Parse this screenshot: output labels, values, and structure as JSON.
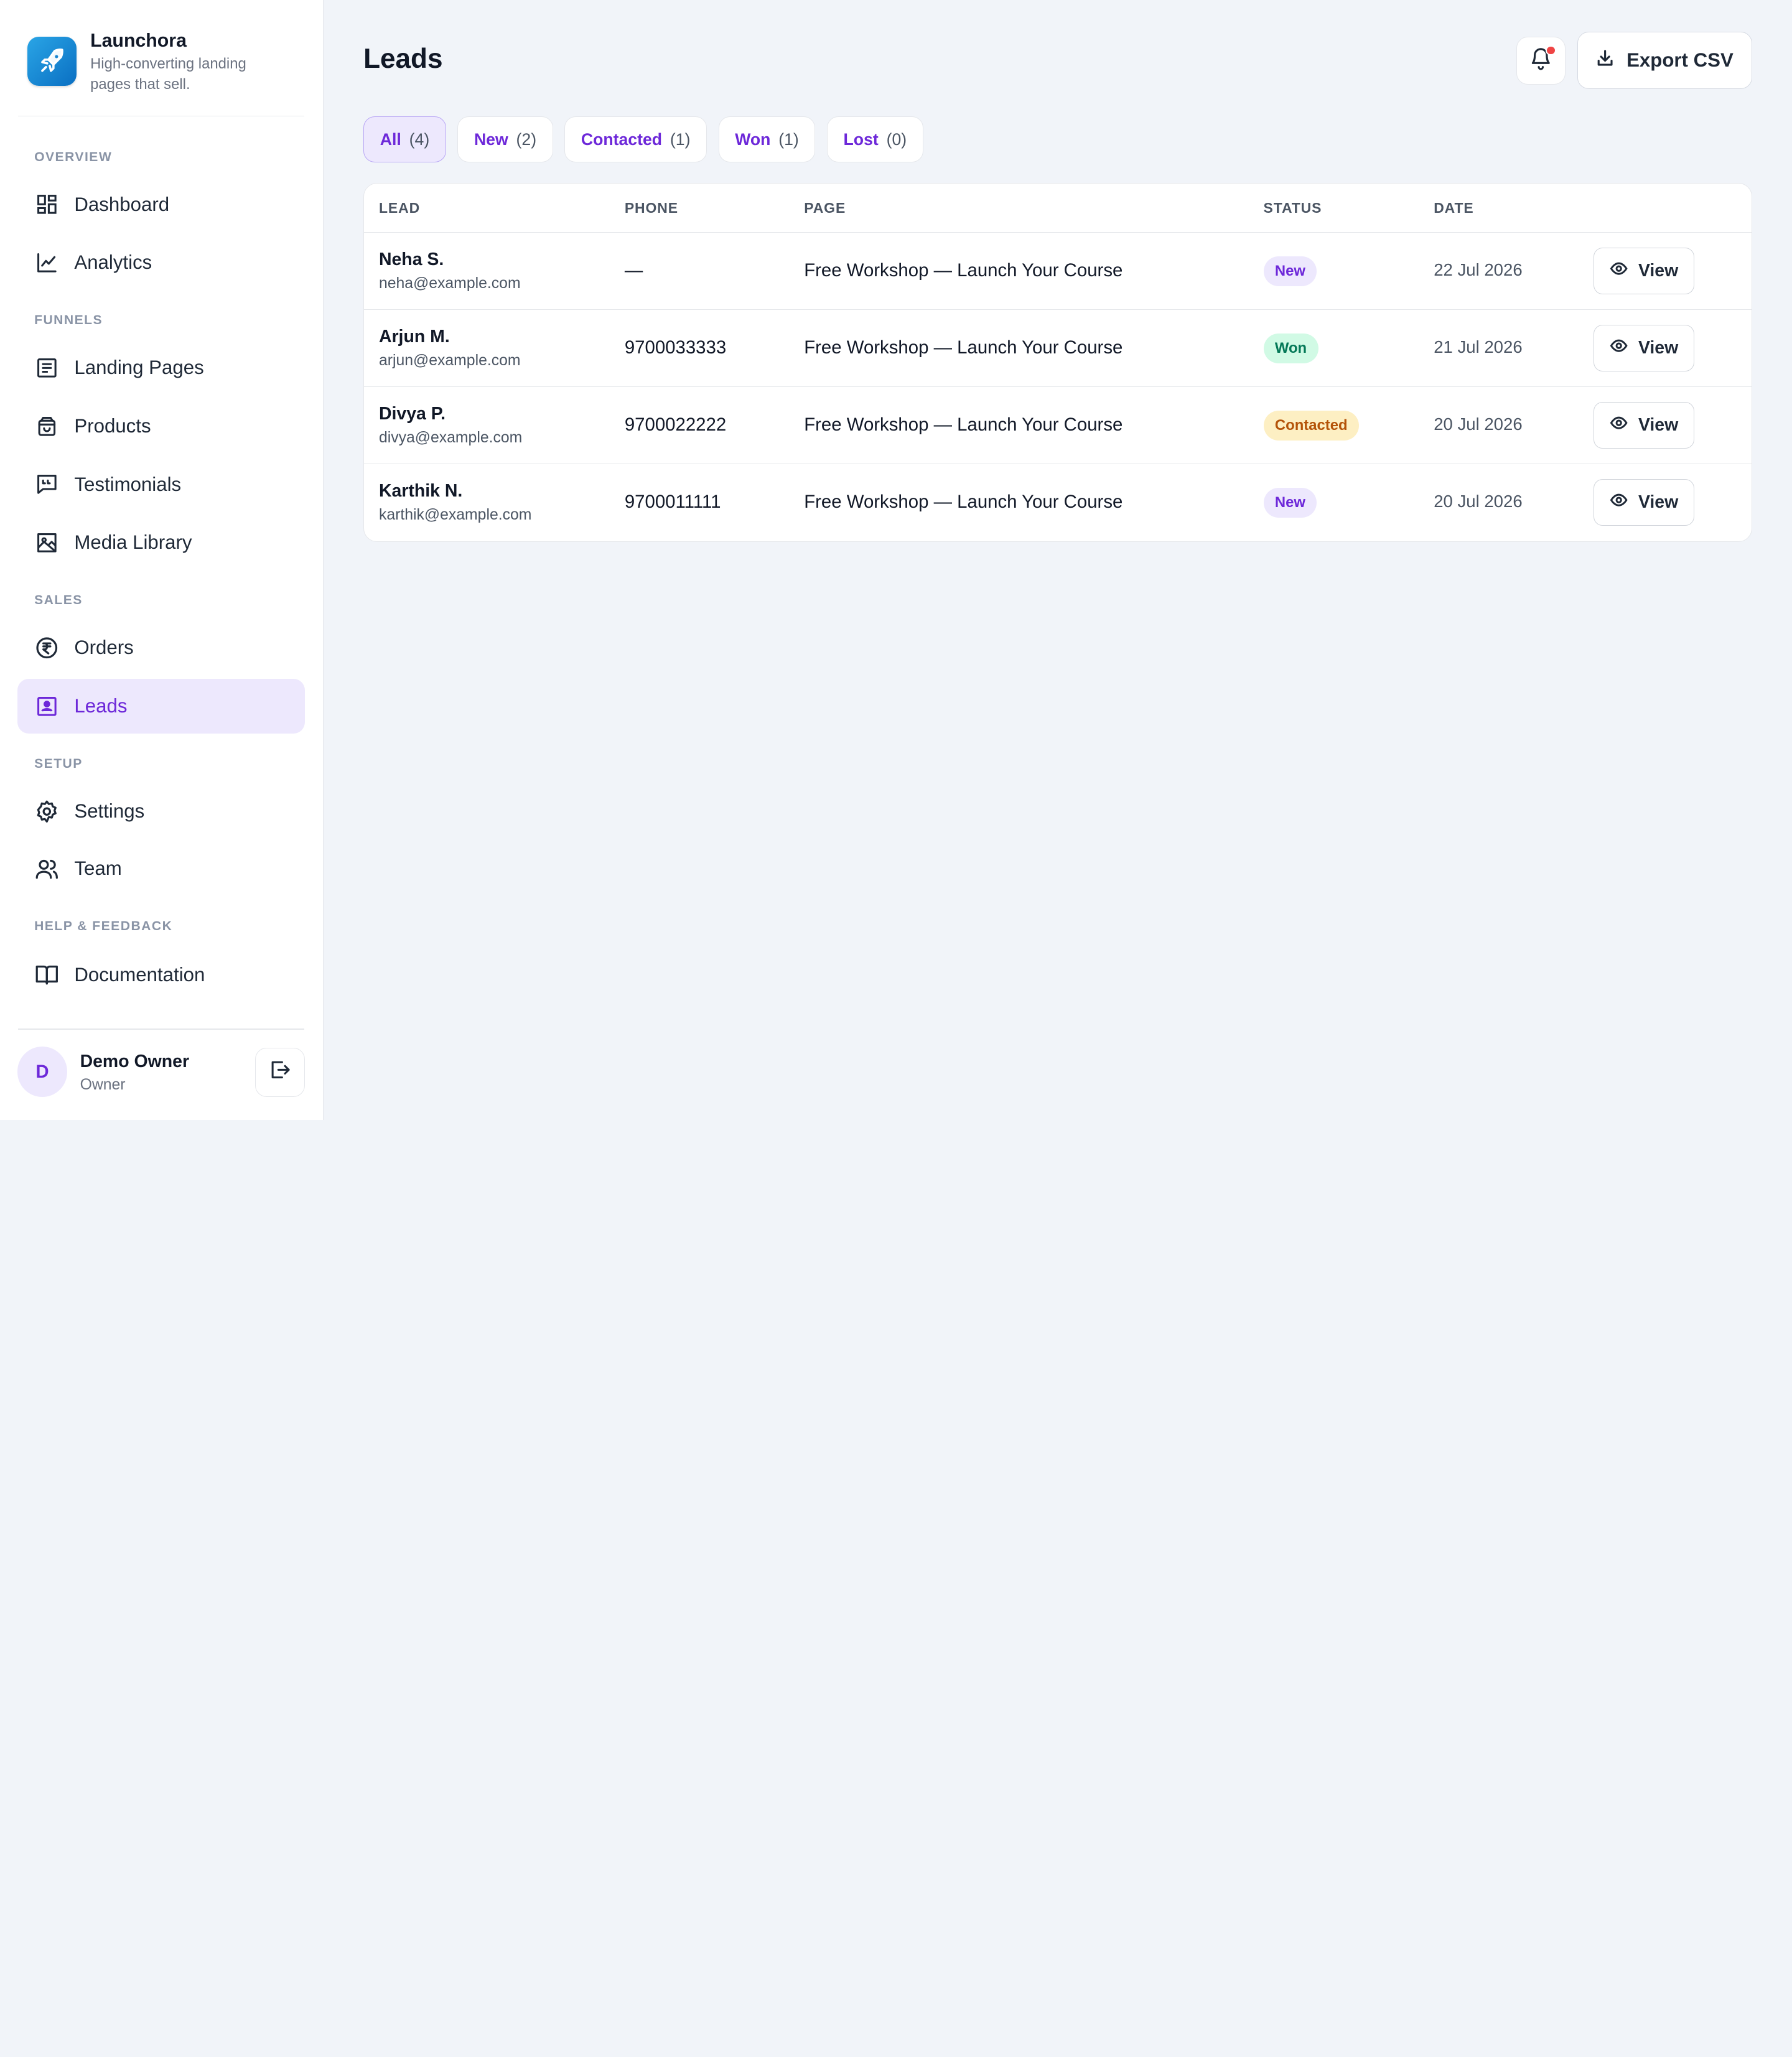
{
  "brand": {
    "name": "Launchora",
    "tagline": "High-converting landing pages that sell."
  },
  "sidebar": {
    "sections": {
      "overview": "OVERVIEW",
      "funnels": "FUNNELS",
      "sales": "SALES",
      "setup": "SETUP",
      "help": "HELP & FEEDBACK"
    },
    "items": {
      "dashboard": "Dashboard",
      "analytics": "Analytics",
      "landing_pages": "Landing Pages",
      "products": "Products",
      "testimonials": "Testimonials",
      "media_library": "Media Library",
      "orders": "Orders",
      "leads": "Leads",
      "settings": "Settings",
      "team": "Team",
      "documentation": "Documentation"
    },
    "user": {
      "initial": "D",
      "name": "Demo Owner",
      "role": "Owner"
    }
  },
  "header": {
    "title": "Leads",
    "export_label": "Export CSV"
  },
  "filters": [
    {
      "label": "All",
      "count": "(4)"
    },
    {
      "label": "New",
      "count": "(2)"
    },
    {
      "label": "Contacted",
      "count": "(1)"
    },
    {
      "label": "Won",
      "count": "(1)"
    },
    {
      "label": "Lost",
      "count": "(0)"
    }
  ],
  "table": {
    "columns": {
      "lead": "LEAD",
      "phone": "PHONE",
      "page": "PAGE",
      "status": "STATUS",
      "date": "DATE"
    },
    "view_label": "View",
    "rows": [
      {
        "name": "Neha S.",
        "email": "neha@example.com",
        "phone": "—",
        "page": "Free Workshop — Launch Your Course",
        "status": "New",
        "date": "22 Jul 2026"
      },
      {
        "name": "Arjun M.",
        "email": "arjun@example.com",
        "phone": "9700033333",
        "page": "Free Workshop — Launch Your Course",
        "status": "Won",
        "date": "21 Jul 2026"
      },
      {
        "name": "Divya P.",
        "email": "divya@example.com",
        "phone": "9700022222",
        "page": "Free Workshop — Launch Your Course",
        "status": "Contacted",
        "date": "20 Jul 2026"
      },
      {
        "name": "Karthik N.",
        "email": "karthik@example.com",
        "phone": "9700011111",
        "page": "Free Workshop — Launch Your Course",
        "status": "New",
        "date": "20 Jul 2026"
      }
    ]
  },
  "colors": {
    "accent": "#6d28d9",
    "accent_bg": "#ede8fd",
    "status_new_bg": "#ede8fd",
    "status_new_fg": "#6d28d9",
    "status_won_bg": "#d1fae5",
    "status_won_fg": "#047857",
    "status_contacted_bg": "#fdefc3",
    "status_contacted_fg": "#b45309",
    "notification_dot": "#ef4444"
  }
}
